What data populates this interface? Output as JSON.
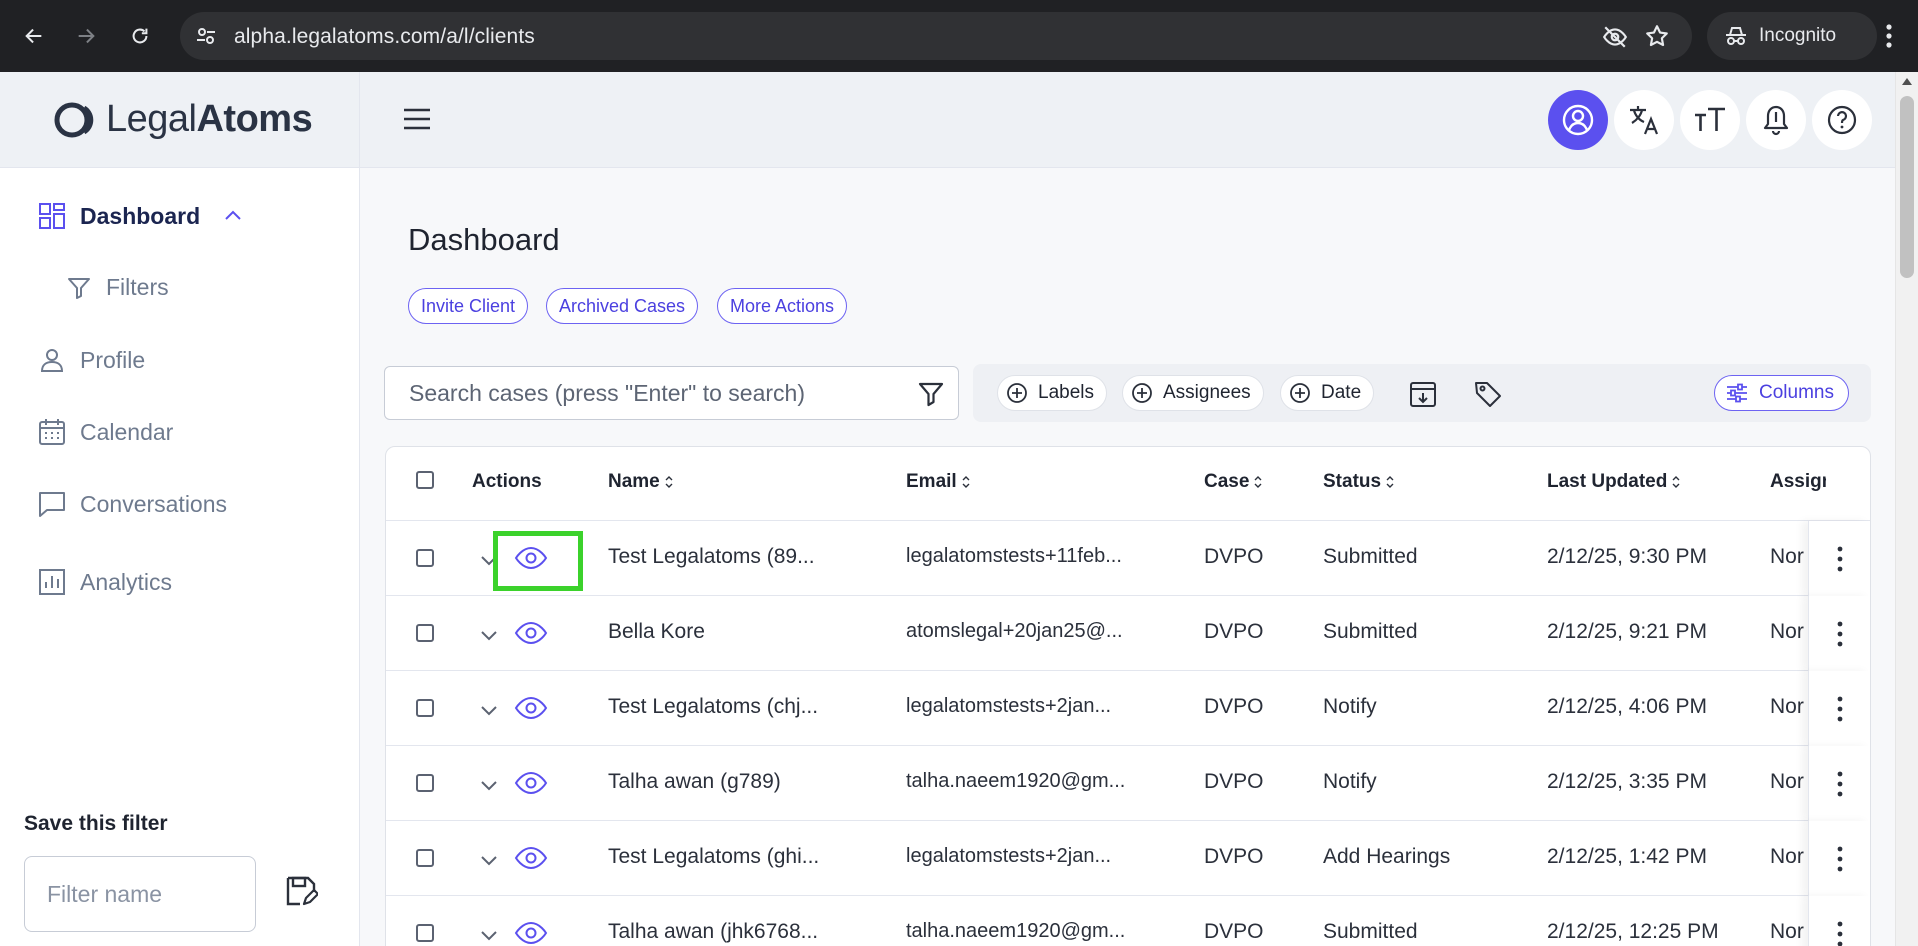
{
  "browser": {
    "url": "alpha.legalatoms.com/a/l/clients",
    "profile_label": "Incognito"
  },
  "brand": {
    "name_light": "Legal",
    "name_bold": "Atoms"
  },
  "sidebar": {
    "items": [
      {
        "label": "Dashboard",
        "icon": "grid-icon",
        "active": true
      },
      {
        "label": "Filters",
        "icon": "filter-icon"
      },
      {
        "label": "Profile",
        "icon": "person-icon"
      },
      {
        "label": "Calendar",
        "icon": "calendar-icon"
      },
      {
        "label": "Conversations",
        "icon": "chat-icon"
      },
      {
        "label": "Analytics",
        "icon": "bar-chart-icon"
      }
    ],
    "save_filter_title": "Save this filter",
    "filter_name_placeholder": "Filter name"
  },
  "main": {
    "title": "Dashboard",
    "actions": [
      "Invite Client",
      "Archived Cases",
      "More Actions"
    ],
    "search_placeholder": "Search cases (press \"Enter\" to search)",
    "filters": {
      "labels": "Labels",
      "assignees": "Assignees",
      "date": "Date",
      "columns": "Columns"
    }
  },
  "table": {
    "headers": [
      "Actions",
      "Name",
      "Email",
      "Case",
      "Status",
      "Last Updated",
      "Assign"
    ],
    "rows": [
      {
        "name": "Test Legalatoms (89...",
        "email": "legalatomstests+11feb...",
        "case": "DVPO",
        "status": "Submitted",
        "updated": "2/12/25, 9:30 PM",
        "assignee": "Nor"
      },
      {
        "name": "Bella Kore",
        "email": "atomslegal+20jan25@...",
        "case": "DVPO",
        "status": "Submitted",
        "updated": "2/12/25, 9:21 PM",
        "assignee": "Nor"
      },
      {
        "name": "Test Legalatoms (chj...",
        "email": "legalatomstests+2jan...",
        "case": "DVPO",
        "status": "Notify",
        "updated": "2/12/25, 4:06 PM",
        "assignee": "Nor"
      },
      {
        "name": "Talha awan (g789)",
        "email": "talha.naeem1920@gm...",
        "case": "DVPO",
        "status": "Notify",
        "updated": "2/12/25, 3:35 PM",
        "assignee": "Nor"
      },
      {
        "name": "Test Legalatoms (ghi...",
        "email": "legalatomstests+2jan...",
        "case": "DVPO",
        "status": "Add Hearings",
        "updated": "2/12/25, 1:42 PM",
        "assignee": "Nor"
      },
      {
        "name": "Talha awan (jhk6768...",
        "email": "talha.naeem1920@gm...",
        "case": "DVPO",
        "status": "Submitted",
        "updated": "2/12/25, 12:25 PM",
        "assignee": "Nor"
      }
    ]
  },
  "colors": {
    "accent": "#5b50ef",
    "highlight": "#3bd22b",
    "chrome_bg": "#202124"
  }
}
